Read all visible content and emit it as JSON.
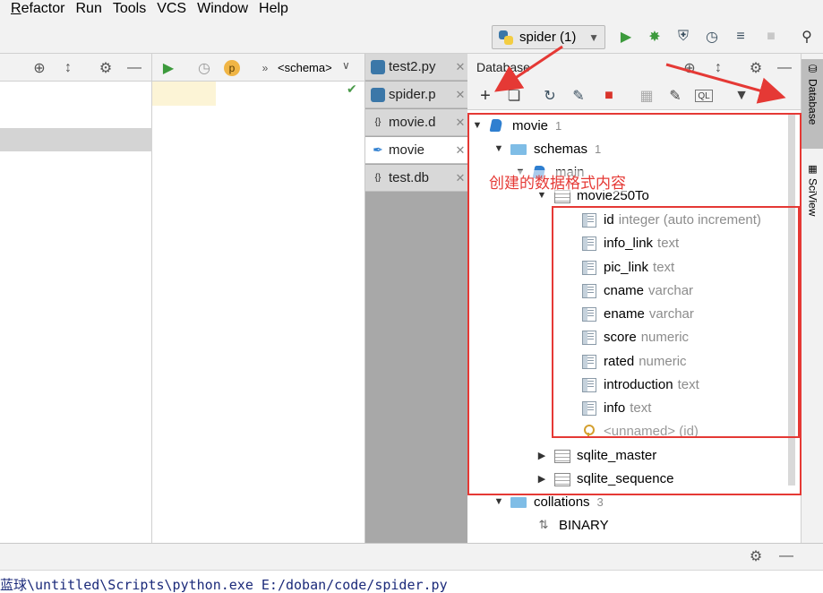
{
  "menu": [
    "Refactor",
    "Run",
    "Tools",
    "VCS",
    "Window",
    "Help"
  ],
  "menu_mnemonic": [
    "R",
    "R",
    "T",
    "",
    "W",
    "H"
  ],
  "run_config": {
    "label": "spider (1)"
  },
  "structure": {
    "breadcrumb": "<schema>",
    "badge": "p"
  },
  "editor_tabs": [
    {
      "label": "test2.py"
    },
    {
      "label": "spider.p"
    },
    {
      "label": "movie.d"
    },
    {
      "label": "movie"
    },
    {
      "label": "test.db"
    }
  ],
  "db_panel": {
    "title": "Database"
  },
  "tree": {
    "database": {
      "name": "movie",
      "count": "1"
    },
    "schemas": {
      "name": "schemas",
      "count": "1"
    },
    "main": {
      "name": "main"
    },
    "table": {
      "name": "movie250To"
    },
    "columns": [
      {
        "name": "id",
        "type": "integer (auto increment)"
      },
      {
        "name": "info_link",
        "type": "text"
      },
      {
        "name": "pic_link",
        "type": "text"
      },
      {
        "name": "cname",
        "type": "varchar"
      },
      {
        "name": "ename",
        "type": "varchar"
      },
      {
        "name": "score",
        "type": "numeric"
      },
      {
        "name": "rated",
        "type": "numeric"
      },
      {
        "name": "introduction",
        "type": "text"
      },
      {
        "name": "info",
        "type": "text"
      }
    ],
    "unnamed_key": "<unnamed> (id)",
    "sqlite_master": "sqlite_master",
    "sqlite_sequence": "sqlite_sequence",
    "collations": {
      "name": "collations",
      "count": "3"
    },
    "binary": "BINARY"
  },
  "annotation": "创建的数据格式内容",
  "side_tabs": {
    "database": "Database",
    "sciview": "SciView"
  },
  "console": {
    "command": "蓝球\\untitled\\Scripts\\python.exe E:/doban/code/spider.py"
  },
  "colors": {
    "annotation_red": "#e53935",
    "run_green": "#3c9a3c",
    "db_blue": "#2f7fd0"
  }
}
